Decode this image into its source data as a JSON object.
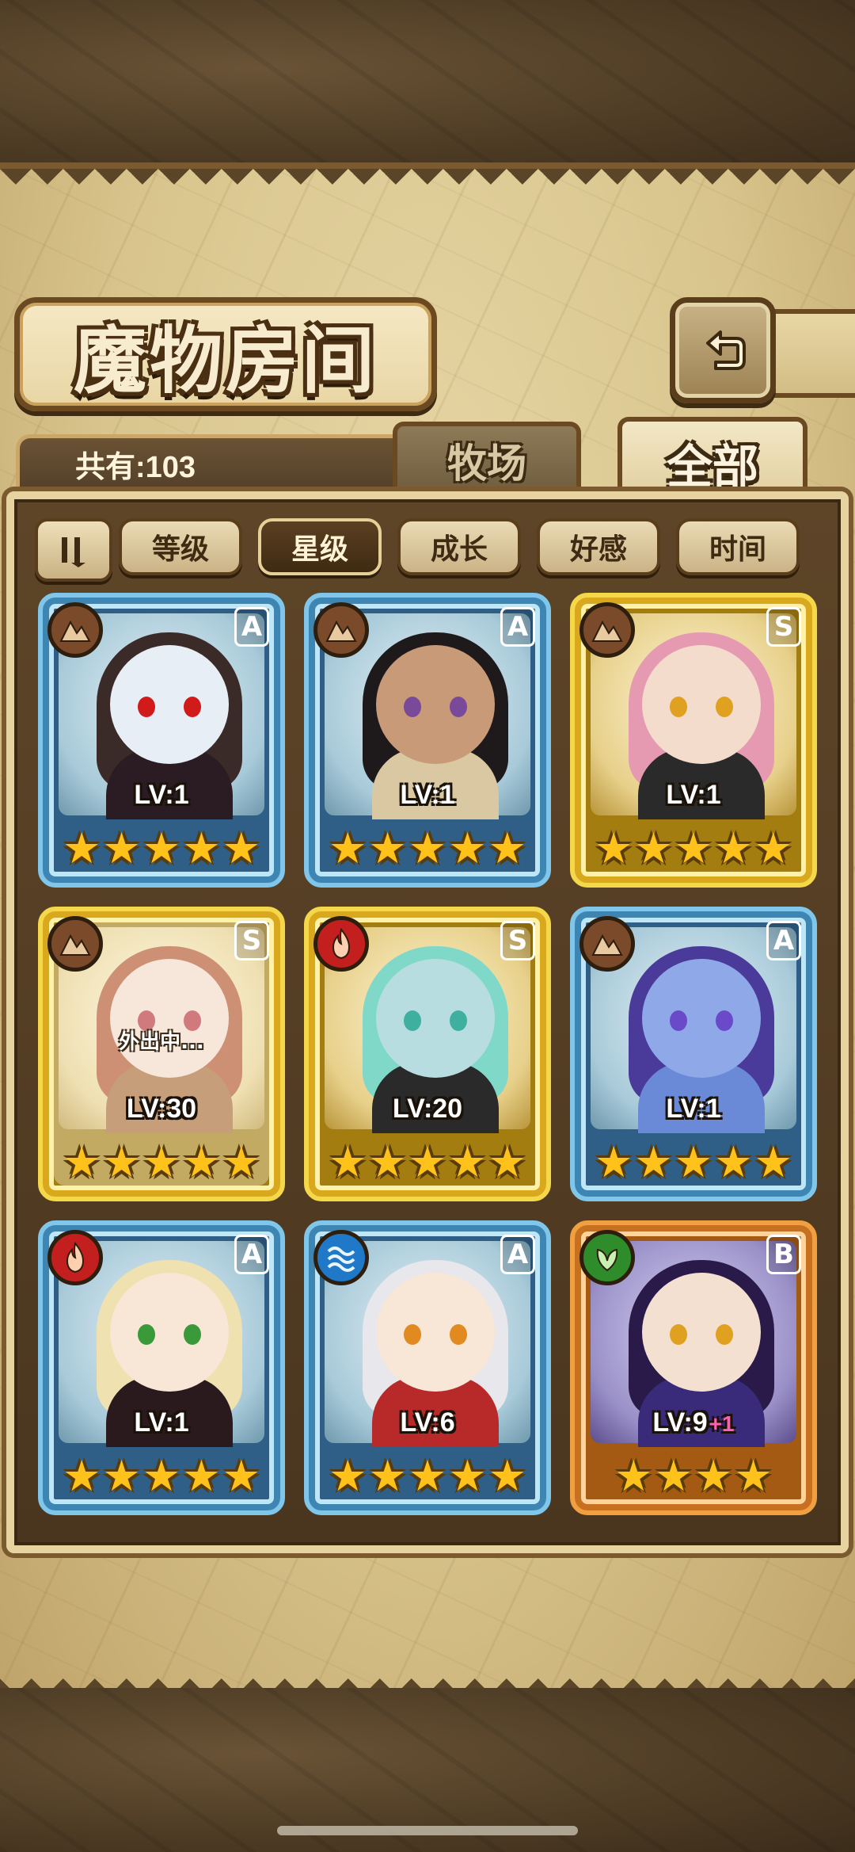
{
  "header": {
    "title": "魔物房间"
  },
  "summary": {
    "count_label": "共有:103"
  },
  "tabs": [
    {
      "label": "牧场",
      "active": false
    },
    {
      "label": "全部",
      "active": true
    }
  ],
  "sort_buttons": [
    {
      "label": "等级",
      "active": false
    },
    {
      "label": "星级",
      "active": true
    },
    {
      "label": "成长",
      "active": false
    },
    {
      "label": "好感",
      "active": false
    },
    {
      "label": "时间",
      "active": false
    }
  ],
  "monsters": [
    {
      "element": "earth-icon",
      "rank": "A",
      "level": "LV:1",
      "plus": "",
      "stars": 5,
      "status": "",
      "hair": "#3a2a28",
      "body": "#2a1c22",
      "eye": "#d11a1a",
      "skin": "#e8eef5"
    },
    {
      "element": "earth-icon",
      "rank": "A",
      "level": "LV:1",
      "plus": "",
      "stars": 5,
      "status": "",
      "hair": "#1e1a1c",
      "body": "#d9c8a2",
      "eye": "#7a4a9a",
      "skin": "#c99a78"
    },
    {
      "element": "earth-icon",
      "rank": "S",
      "level": "LV:1",
      "plus": "",
      "stars": 5,
      "status": "",
      "hair": "#e59ab2",
      "body": "#2a2a2a",
      "eye": "#e0a020",
      "skin": "#f3dccc"
    },
    {
      "element": "earth-icon",
      "rank": "S",
      "level": "LV:30",
      "plus": "",
      "stars": 5,
      "status": "外出中...",
      "hair": "#b4552a",
      "body": "#a86a32",
      "eye": "#b8343a",
      "skin": "#f3d9c6"
    },
    {
      "element": "fire-icon",
      "rank": "S",
      "level": "LV:20",
      "plus": "",
      "stars": 5,
      "status": "",
      "hair": "#7fd8c8",
      "body": "#2a2a2a",
      "eye": "#3fb0a0",
      "skin": "#b8dde0"
    },
    {
      "element": "earth-icon",
      "rank": "A",
      "level": "LV:1",
      "plus": "",
      "stars": 5,
      "status": "",
      "hair": "#4a3a9a",
      "body": "#6a8ad8",
      "eye": "#6a4ac8",
      "skin": "#8fa8e8"
    },
    {
      "element": "fire-icon",
      "rank": "A",
      "level": "LV:1",
      "plus": "",
      "stars": 5,
      "status": "",
      "hair": "#f0e2b0",
      "body": "#2a1a1e",
      "eye": "#3a9a3a",
      "skin": "#f8e6d6"
    },
    {
      "element": "water-icon",
      "rank": "A",
      "level": "LV:6",
      "plus": "",
      "stars": 5,
      "status": "",
      "hair": "#e8e8ec",
      "body": "#b82a2a",
      "eye": "#e08a20",
      "skin": "#f8e6d6"
    },
    {
      "element": "wood-icon",
      "rank": "B",
      "level": "LV:9",
      "plus": "+1",
      "stars": 4,
      "status": "",
      "hair": "#2a1a4a",
      "body": "#3a2a7a",
      "eye": "#e0a020",
      "skin": "#f3e0d0"
    }
  ],
  "colors": {
    "accent_dark": "#4a2f12",
    "parchment": "#e7d7a6",
    "star": "#ffc21a",
    "rank_A": "#3d86b3",
    "rank_S": "#d9a81d",
    "rank_B": "#c67020"
  }
}
